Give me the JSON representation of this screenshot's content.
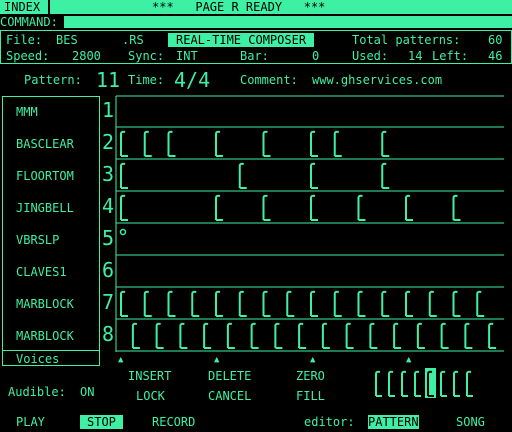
{
  "header": {
    "index_label": "INDEX",
    "status": "***   PAGE R READY   ***",
    "command_label": "COMMAND:"
  },
  "info": {
    "file_label": "File:",
    "file_name": "BES",
    "file_ext": ".RS",
    "mode": "REAL-TIME COMPOSER",
    "total_label": "Total patterns:",
    "total_value": "60",
    "speed_label": "Speed:",
    "speed_value": "2800",
    "sync_label": "Sync:",
    "sync_value": "INT",
    "bar_label": "Bar:",
    "bar_value": "0",
    "used_label": "Used:",
    "used_value": "14",
    "left_label": "Left:",
    "left_value": "46"
  },
  "pattern_line": {
    "pattern_label": "Pattern:",
    "pattern_value": "11",
    "time_label": "Time:",
    "time_value": "4/4",
    "comment_label": "Comment:",
    "comment_value": "www.ghservices.com"
  },
  "voices": {
    "title": "Voices",
    "tracks": [
      {
        "num": "1",
        "name": "MMM",
        "notes": []
      },
      {
        "num": "2",
        "name": "BASCLEAR",
        "notes": [
          0,
          2,
          4,
          8,
          12,
          16,
          18,
          22
        ]
      },
      {
        "num": "3",
        "name": "FLOORTOM",
        "notes": [
          0,
          10,
          16,
          22
        ]
      },
      {
        "num": "4",
        "name": "JINGBELL",
        "notes": [
          0,
          8,
          12,
          16,
          20,
          24,
          28
        ]
      },
      {
        "num": "5",
        "name": "VBRSLP",
        "notes": [
          0
        ]
      },
      {
        "num": "6",
        "name": "CLAVES1",
        "notes": []
      },
      {
        "num": "7",
        "name": "MARBLOCK",
        "notes": [
          0,
          2,
          4,
          6,
          8,
          10,
          12,
          14,
          16,
          18,
          20,
          22,
          24,
          26,
          28,
          30
        ]
      },
      {
        "num": "8",
        "name": "MARBLOCK",
        "notes": [
          1,
          3,
          5,
          7,
          9,
          11,
          13,
          15,
          17,
          19,
          21,
          23,
          25,
          27,
          29,
          31
        ]
      }
    ]
  },
  "controls": {
    "audible_label": "Audible:",
    "audible_value": "ON",
    "insert": "INSERT",
    "delete": "DELETE",
    "zero": "ZERO",
    "lock": "LOCK",
    "cancel": "CANCEL",
    "fill": "FILL",
    "note_selected_index": 4
  },
  "bottom": {
    "play": "PLAY",
    "stop": "STOP",
    "record": "RECORD",
    "editor_label": "editor:",
    "pattern": "PATTERN",
    "song": "SONG"
  },
  "colors": {
    "fg": "#3ef0a4",
    "bg": "#000000"
  }
}
